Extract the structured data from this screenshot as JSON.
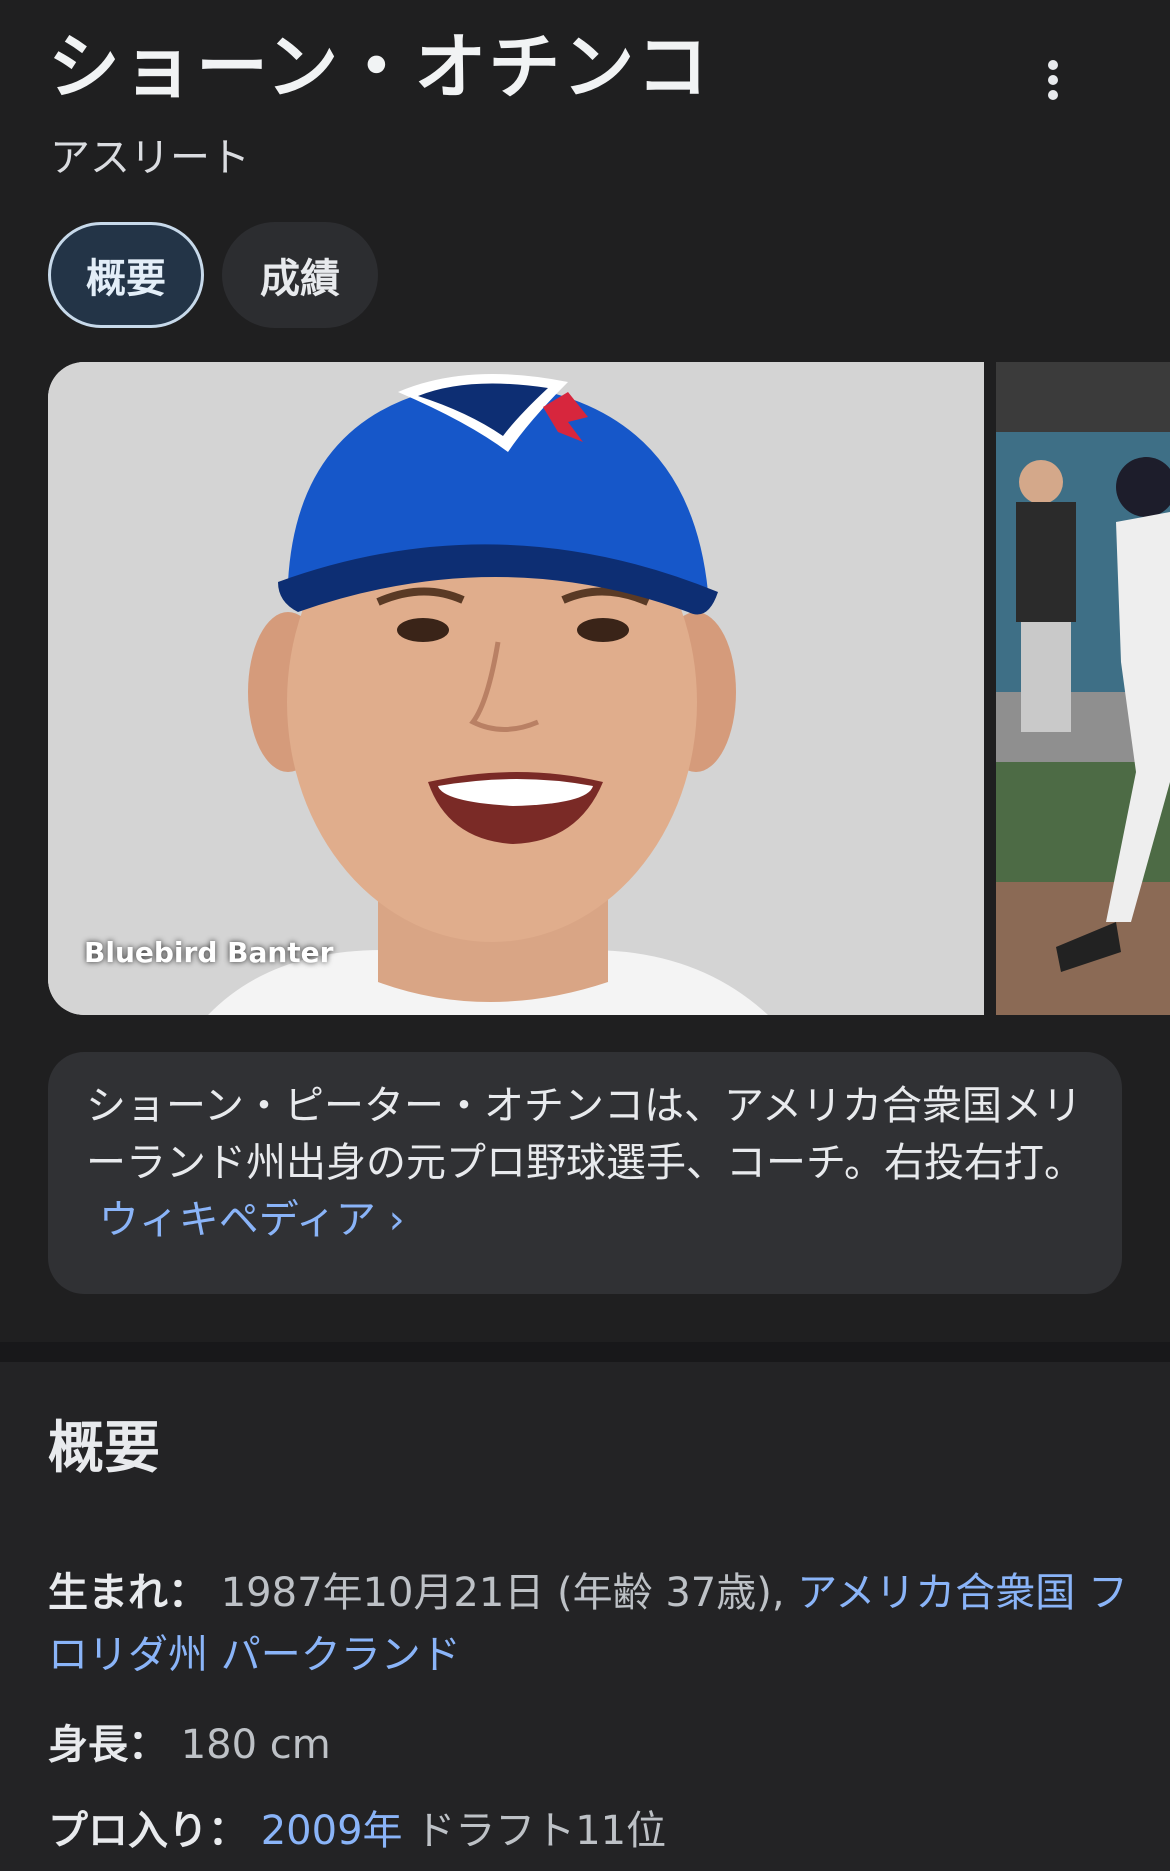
{
  "header": {
    "title": "ショーン・オチンコ",
    "subtitle": "アスリート",
    "more_icon": "more-vert-icon"
  },
  "tabs": [
    {
      "label": "概要",
      "active": true
    },
    {
      "label": "成績",
      "active": false
    }
  ],
  "images": {
    "main_credit": "Bluebird Banter"
  },
  "description": {
    "text": "ショーン・ピーター・オチンコは、アメリカ合衆国メリーランド州出身の元プロ野球選手、コーチ。右投右打。",
    "link_text": "ウィキペディア",
    "link_arrow": "›"
  },
  "overview": {
    "title": "概要",
    "born": {
      "label": "生まれ：",
      "value": "1987年10月21日 (年齢 37歳), ",
      "place_link": "アメリカ合衆国 フロリダ州 パークランド"
    },
    "height": {
      "label": "身長：",
      "value": "180 cm"
    },
    "pro": {
      "label": "プロ入り：",
      "year_link": "2009年",
      "value": " ドラフト11位"
    }
  },
  "colors": {
    "background": "#1f1f20",
    "chip_active_bg": "#233447",
    "card_bg": "#303134",
    "link": "#8ab4f8"
  }
}
